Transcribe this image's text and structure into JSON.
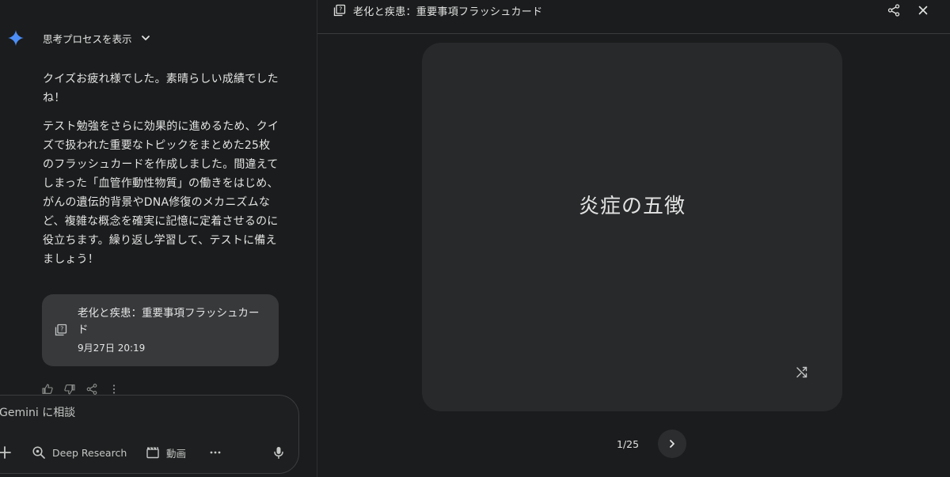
{
  "chat": {
    "thought_toggle": "思考プロセスを表示",
    "paragraphs": [
      "クイズお疲れ様でした。素晴らしい成績でしたね！",
      "テスト勉強をさらに効果的に進めるため、クイズで扱われた重要なトピックをまとめた25枚のフラッシュカードを作成しました。間違えてしまった「血管作動性物質」の働きをはじめ、がんの遺伝的背景やDNA修復のメカニズムなど、複雑な概念を確実に記憶に定着させるのに役立ちます。繰り返し学習して、テストに備えましょう！"
    ],
    "attachment": {
      "title": "老化と疾患：重要事項フラッシュカード",
      "date": "9月27日 20:19",
      "icon": "flashcard-icon"
    }
  },
  "composer": {
    "placeholder": "Gemini に相談",
    "tools": {
      "deep_research": "Deep Research",
      "video": "動画"
    }
  },
  "panel": {
    "title": "老化と疾患：重要事項フラッシュカード",
    "card_front": "炎症の五徴",
    "counter": "1/25"
  },
  "colors": {
    "accent_blue": "#4c8df6",
    "card_bg": "#28292b",
    "chip_bg": "#37393b"
  }
}
